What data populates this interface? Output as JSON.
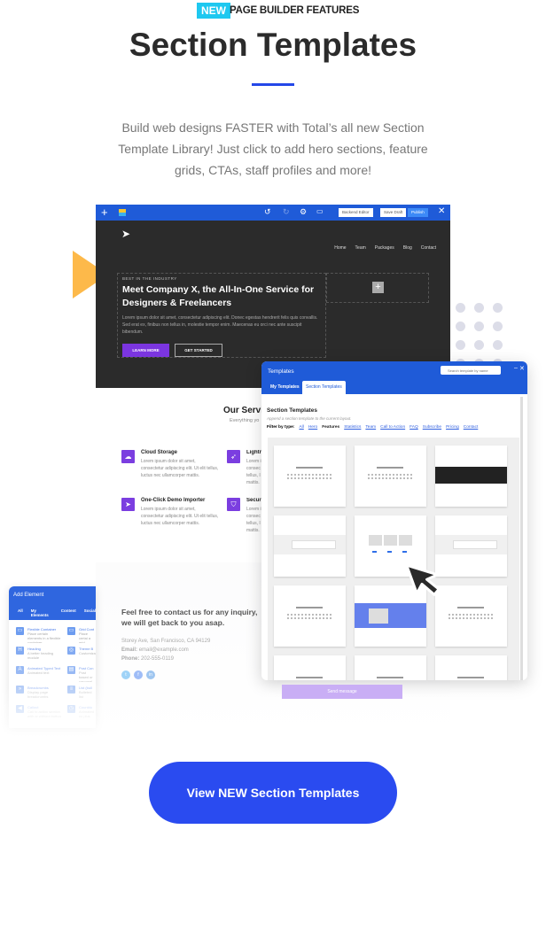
{
  "header": {
    "badge": "NEW",
    "eyebrow": "PAGE BUILDER FEATURES",
    "title": "Section Templates",
    "intro": "Build web designs FASTER with Total’s all new Section Template Library! Just click to add hero sections, feature grids, CTAs, staff profiles and more!"
  },
  "colors": {
    "accent": "#2447e8",
    "badge": "#1ec8f0",
    "builder_blue": "#1f5bd8",
    "purple": "#7b3ee0",
    "triangle": "#fdb94a"
  },
  "builder": {
    "toolbar": {
      "backend": "Backend Editor",
      "save": "Save Draft",
      "publish": "Publish"
    },
    "nav": [
      "Home",
      "Team",
      "Packages",
      "Blog",
      "Contact"
    ],
    "hero": {
      "kicker": "BEST IN THE INDUSTRY",
      "heading": "Meet Company X, the All-In-One Service for Designers & Freelancers",
      "body": "Lorem ipsum dolor sit amet, consectetur adipiscing elit. Donec egestas hendrerit felis quis convallis. Sed erat ex, finibus non tellus in, molestie tempor enim. Maecenas eu orci nec ante suscipit bibendum.",
      "btn1": "LEARN MORE",
      "btn2": "GET STARTED"
    },
    "services": {
      "title": "Our Servi",
      "subtitle": "Everything yo",
      "items": [
        {
          "title": "Cloud Storage",
          "text": "Lorem ipsum dolor sit amet, consectetur adipiscing elit. Ut elit tellus, luctus nec ullamcorper mattis."
        },
        {
          "title": "Lightn",
          "text": "Lorem i consec tellus, l mattis."
        },
        {
          "title": "One-Click Demo Importer",
          "text": "Lorem ipsum dolor sit amet, consectetur adipiscing elit. Ut elit tellus, luctus nec ullamcorper mattis."
        },
        {
          "title": "Securi",
          "text": "Lorem i consec tellus, l mattis."
        }
      ]
    },
    "contact": {
      "heading": "Feel free to contact us for any inquiry, we will get back to you asap.",
      "address": "Storey Ave, San Francisco, CA 94129",
      "email_label": "Email:",
      "email": "email@example.com",
      "phone_label": "Phone:",
      "phone": "202-555-0119",
      "send": "Send message"
    }
  },
  "templates": {
    "title": "Templates",
    "search_placeholder": "Search template by name",
    "tabs": [
      "My Templates",
      "Section Templates"
    ],
    "heading": "Section Templates",
    "sub": "Append a section template to the current layout.",
    "filter_label": "Filter by type:",
    "filters": [
      "All",
      "Hero",
      "Features",
      "Statistics",
      "Team",
      "Call to Action",
      "FAQ",
      "Subscribe",
      "Pricing",
      "Contact"
    ],
    "active_filter": "Features"
  },
  "add_element": {
    "title": "Add Element",
    "tabs": [
      "All",
      "My Elements",
      "Content",
      "Social"
    ],
    "items": [
      {
        "name": "Flexible Container",
        "desc": "Place certain elements in a flexible container."
      },
      {
        "name": "Grid Cont",
        "desc": "Place certai a grid."
      },
      {
        "name": "Heading",
        "desc": "A better heading module"
      },
      {
        "name": "Theme B",
        "desc": "Customizabl"
      },
      {
        "name": "Animated Typed Text",
        "desc": "Animated text"
      },
      {
        "name": "Post Con",
        "desc": "Post based or carousel"
      },
      {
        "name": "Breadcrumbs",
        "desc": "Display page breadcrumbs"
      },
      {
        "name": "List (bull",
        "desc": "Bulleted list"
      },
      {
        "name": "Callout",
        "desc": "Call to action section with or without button"
      },
      {
        "name": "Countdo",
        "desc": "Animated co plus"
      }
    ]
  },
  "cta": "View NEW Section Templates"
}
